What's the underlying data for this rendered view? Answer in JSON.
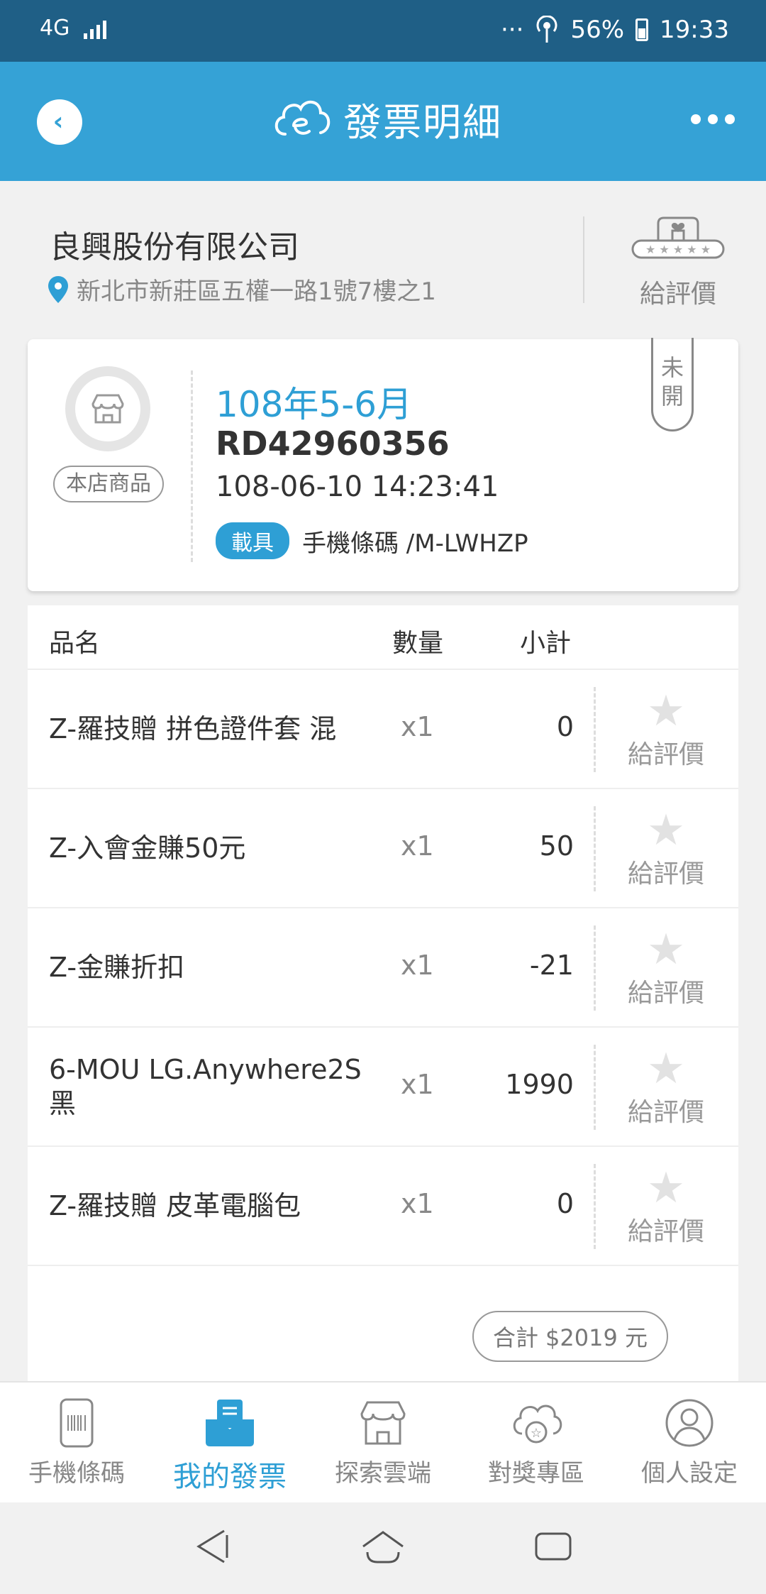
{
  "status_bar": {
    "network": "4G",
    "dots": "···",
    "battery": "56%",
    "time": "19:33"
  },
  "header": {
    "title": "發票明細"
  },
  "store": {
    "name": "良興股份有限公司",
    "address": "新北市新莊區五權一路1號7樓之1",
    "rate_label": "給評價"
  },
  "invoice": {
    "own_goods_label": "本店商品",
    "period": "108年5-6月",
    "number": "RD42960356",
    "datetime": "108-06-10 14:23:41",
    "carrier_label": "載具",
    "carrier_value": "手機條碼 /M-LWHZP",
    "status_line1": "未",
    "status_line2": "開"
  },
  "table": {
    "headers": {
      "name": "品名",
      "qty": "數量",
      "subtotal": "小計"
    },
    "rows": [
      {
        "name": "Z-羅技贈 拼色證件套 混",
        "qty": "x1",
        "subtotal": "0",
        "rate_label": "給評價"
      },
      {
        "name": "Z-入會金賺50元",
        "qty": "x1",
        "subtotal": "50",
        "rate_label": "給評價"
      },
      {
        "name": "Z-金賺折扣",
        "qty": "x1",
        "subtotal": "-21",
        "rate_label": "給評價"
      },
      {
        "name": "6-MOU LG.Anywhere2S 黑",
        "qty": "x1",
        "subtotal": "1990",
        "rate_label": "給評價"
      },
      {
        "name": "Z-羅技贈 皮革電腦包",
        "qty": "x1",
        "subtotal": "0",
        "rate_label": "給評價"
      }
    ],
    "total_label": "合計",
    "total_value": "$2019 元"
  },
  "bottom_nav": {
    "items": [
      {
        "label": "手機條碼",
        "icon": "phone-barcode-icon"
      },
      {
        "label": "我的發票",
        "icon": "my-invoice-icon"
      },
      {
        "label": "探索雲端",
        "icon": "store-icon"
      },
      {
        "label": "對獎專區",
        "icon": "cloud-star-icon"
      },
      {
        "label": "個人設定",
        "icon": "person-icon"
      }
    ],
    "active_index": 1
  },
  "colors": {
    "status_bar": "#1f5f86",
    "header": "#35a2d6",
    "accent": "#2e9fd5"
  }
}
